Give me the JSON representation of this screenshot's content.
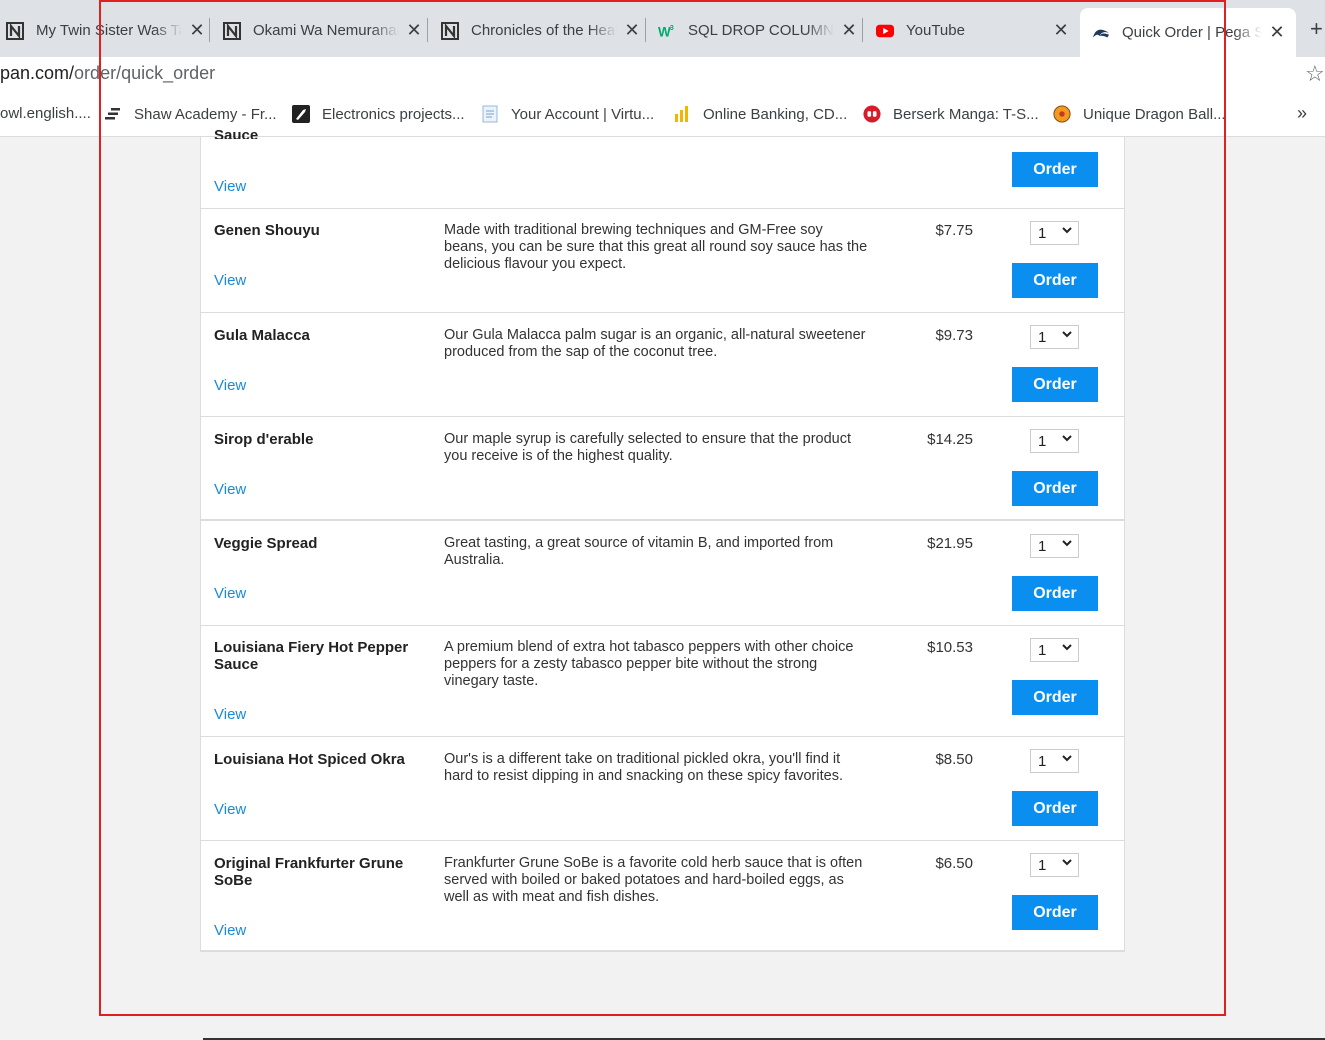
{
  "browser": {
    "tabs": [
      {
        "title": "My Twin Sister Was Taken",
        "icon": "N"
      },
      {
        "title": "Okami Wa Nemuranai",
        "icon": "N"
      },
      {
        "title": "Chronicles of the Heaven",
        "icon": "N"
      },
      {
        "title": "SQL DROP COLUMN",
        "icon": "W3"
      },
      {
        "title": "YouTube",
        "icon": "youtube"
      },
      {
        "title": "Quick Order | Pega Sandbox",
        "icon": "pega"
      }
    ],
    "url_domain": "pan.com/",
    "url_path": "order/quick_order",
    "bookmarks": [
      {
        "label": "owl.english...."
      },
      {
        "label": "Shaw Academy - Fr..."
      },
      {
        "label": "Electronics projects..."
      },
      {
        "label": "Your Account | Virtu..."
      },
      {
        "label": "Online Banking, CD..."
      },
      {
        "label": "Berserk Manga: T-S..."
      },
      {
        "label": "Unique Dragon Ball..."
      }
    ],
    "more": "»"
  },
  "products_partial": {
    "name_fragment": "Sauce",
    "view_label": "View",
    "order_label": "Order"
  },
  "products": [
    {
      "name": "Genen Shouyu",
      "description": "Made with traditional brewing techniques and GM-Free soy beans, you can be sure that this great all round soy sauce has the delicious flavour you expect.",
      "price": "$7.75",
      "qty": "1",
      "view_label": "View",
      "order_label": "Order"
    },
    {
      "name": "Gula Malacca",
      "description": "Our Gula Malacca palm sugar is an organic, all-natural sweetener produced from the sap of the coconut tree.",
      "price": "$9.73",
      "qty": "1",
      "view_label": "View",
      "order_label": "Order"
    },
    {
      "name": "Sirop d'erable",
      "description": "Our maple syrup is carefully selected to ensure that the product you receive is of the highest quality.",
      "price": "$14.25",
      "qty": "1",
      "view_label": "View",
      "order_label": "Order"
    },
    {
      "name": "Veggie Spread",
      "description": "Great tasting, a great source of vitamin B, and imported from Australia.",
      "price": "$21.95",
      "qty": "1",
      "view_label": "View",
      "order_label": "Order"
    },
    {
      "name": "Louisiana Fiery Hot Pepper Sauce",
      "description": "A premium blend of extra hot tabasco peppers with other choice peppers for a zesty tabasco pepper bite without the strong vinegary taste.",
      "price": "$10.53",
      "qty": "1",
      "view_label": "View",
      "order_label": "Order"
    },
    {
      "name": "Louisiana Hot Spiced Okra",
      "description": "Our's is a different take on traditional pickled okra, you'll find it hard to resist dipping in and snacking on these spicy favorites.",
      "price": "$8.50",
      "qty": "1",
      "view_label": "View",
      "order_label": "Order"
    },
    {
      "name": "Original Frankfurter Grune SoBe",
      "description": "Frankfurter Grune SoBe is a favorite cold herb sauce that is often served with boiled or baked potatoes and hard-boiled eggs, as well as with meat and fish dishes.",
      "price": "$6.50",
      "qty": "1",
      "view_label": "View",
      "order_label": "Order"
    }
  ],
  "colors": {
    "accent": "#0a8ff0",
    "link": "#1a8ad8",
    "annotation_frame": "#e02020"
  }
}
